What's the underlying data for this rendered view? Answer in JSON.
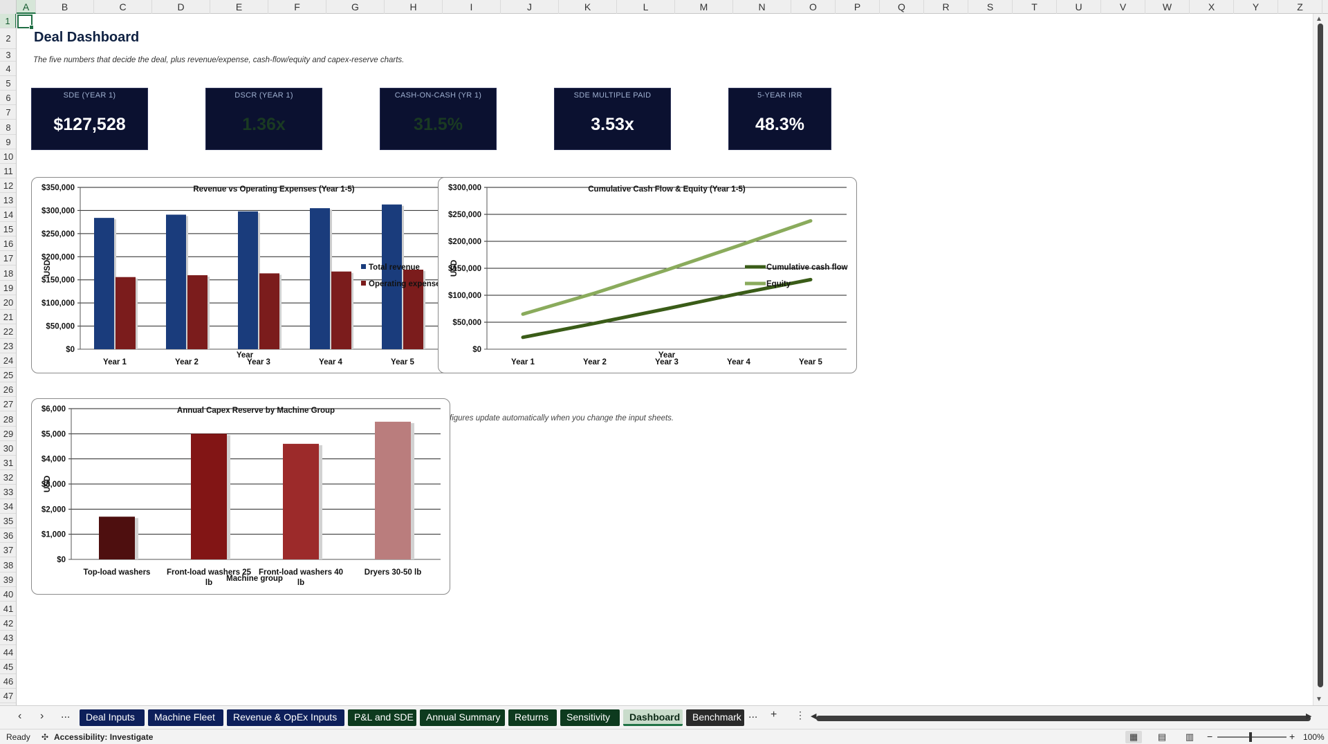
{
  "columns": [
    "A",
    "B",
    "C",
    "D",
    "E",
    "F",
    "G",
    "H",
    "I",
    "J",
    "K",
    "L",
    "M",
    "N",
    "O",
    "P",
    "Q",
    "R",
    "S",
    "T",
    "U",
    "V",
    "W",
    "X",
    "Y",
    "Z"
  ],
  "rows": [
    "1",
    "2",
    "3",
    "4",
    "5",
    "6",
    "7",
    "8",
    "9",
    "10",
    "11",
    "12",
    "13",
    "14",
    "15",
    "16",
    "17",
    "18",
    "19",
    "20",
    "21",
    "22",
    "23",
    "24",
    "25",
    "26",
    "27",
    "28",
    "29",
    "30",
    "31",
    "32",
    "33",
    "34",
    "35",
    "36",
    "37",
    "38",
    "39",
    "40",
    "41",
    "42",
    "43",
    "44",
    "45",
    "46",
    "47"
  ],
  "sheet": {
    "title": "Deal Dashboard",
    "subtitle": "The five numbers that decide the deal, plus revenue/expense, cash-flow/equity and capex-reserve charts.",
    "note": "figures update automatically when you change the input sheets."
  },
  "kpis": [
    {
      "label": "SDE (YEAR 1)",
      "value": "$127,528"
    },
    {
      "label": "DSCR (YEAR 1)",
      "value": "1.36x"
    },
    {
      "label": "CASH-ON-CASH (YR 1)",
      "value": "31.5%"
    },
    {
      "label": "SDE MULTIPLE PAID",
      "value": "3.53x"
    },
    {
      "label": "5-YEAR IRR",
      "value": "48.3%"
    }
  ],
  "colors": {
    "revenue": "#1a3c7c",
    "opex": "#7b1c1c",
    "cumcf": "#3a5c18",
    "equity": "#8aab5c",
    "capex": [
      "#4e0f0f",
      "#821515",
      "#9c2a2a",
      "#ba7d7d"
    ],
    "kpi_bg": "#0b1130"
  },
  "chart_data": [
    {
      "type": "bar",
      "title": "Revenue vs Operating Expenses (Year 1-5)",
      "xlabel": "Year",
      "ylabel": "USD",
      "categories": [
        "Year 1",
        "Year 2",
        "Year 3",
        "Year 4",
        "Year 5"
      ],
      "ylim": [
        0,
        350000
      ],
      "yticks": [
        "$0",
        "$50,000",
        "$100,000",
        "$150,000",
        "$200,000",
        "$250,000",
        "$300,000",
        "$350,000"
      ],
      "series": [
        {
          "name": "Total revenue",
          "values": [
            284000,
            291000,
            298000,
            305000,
            313000
          ]
        },
        {
          "name": "Operating expenses",
          "values": [
            156000,
            160000,
            164000,
            168000,
            172000
          ]
        }
      ],
      "legend": "right"
    },
    {
      "type": "line",
      "title": "Cumulative Cash Flow & Equity (Year 1-5)",
      "xlabel": "Year",
      "ylabel": "USD",
      "categories": [
        "Year 1",
        "Year 2",
        "Year 3",
        "Year 4",
        "Year 5"
      ],
      "ylim": [
        0,
        300000
      ],
      "yticks": [
        "$0",
        "$50,000",
        "$100,000",
        "$150,000",
        "$200,000",
        "$250,000",
        "$300,000"
      ],
      "series": [
        {
          "name": "Cumulative cash flow",
          "values": [
            22000,
            48000,
            75000,
            103000,
            129000
          ]
        },
        {
          "name": "Equity",
          "values": [
            65000,
            104000,
            147000,
            192000,
            238000
          ]
        }
      ],
      "legend": "right"
    },
    {
      "type": "bar",
      "title": "Annual Capex Reserve by Machine Group",
      "xlabel": "Machine group",
      "ylabel": "USD",
      "categories": [
        "Top-load washers",
        "Front-load washers 25 lb",
        "Front-load washers 40 lb",
        "Dryers 30-50 lb"
      ],
      "ylim": [
        0,
        6000
      ],
      "yticks": [
        "$0",
        "$1,000",
        "$2,000",
        "$3,000",
        "$4,000",
        "$5,000",
        "$6,000"
      ],
      "values": [
        1700,
        5000,
        4600,
        5480
      ]
    }
  ],
  "tabs": {
    "more": "...",
    "items": [
      {
        "label": "Deal Inputs"
      },
      {
        "label": "Machine Fleet"
      },
      {
        "label": "Revenue & OpEx Inputs"
      },
      {
        "label": "P&L and SDE"
      },
      {
        "label": "Annual Summary"
      },
      {
        "label": "Returns"
      },
      {
        "label": "Sensitivity"
      },
      {
        "label": "Dashboard"
      },
      {
        "label": "Benchmark"
      }
    ],
    "add": "+",
    "menu": "⋮"
  },
  "status": {
    "ready": "Ready",
    "accessibility": "Accessibility: Investigate",
    "zoom": "100%"
  }
}
